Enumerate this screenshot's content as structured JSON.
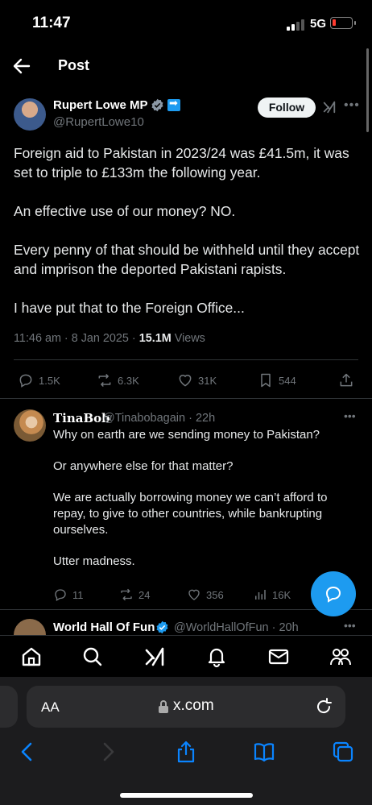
{
  "status_bar": {
    "time": "11:47",
    "network": "5G",
    "battery_color": "#ff3b30"
  },
  "nav": {
    "title": "Post"
  },
  "post": {
    "author_name": "Rupert Lowe MP",
    "author_handle": "@RupertLowe10",
    "follow_label": "Follow",
    "paragraphs": [
      "Foreign aid to Pakistan in 2023/24 was £41.5m, it was set to triple to £133m the following year.",
      "An effective use of our money? NO.",
      "Every penny of that should be withheld until they accept and imprison the deported Pakistani rapists.",
      "I have put that to the Foreign Office..."
    ],
    "timestamp": "11:46 am · 8 Jan 2025 · ",
    "views_count": "15.1M",
    "views_label": " Views",
    "stats": {
      "replies": "1.5K",
      "reposts": "6.3K",
      "likes": "31K",
      "bookmarks": "544"
    }
  },
  "reply": {
    "author_name": "TinaBob",
    "author_handle": "@Tinabobagain · 22h",
    "paragraphs": [
      "Why on earth are we sending money to Pakistan?",
      "Or anywhere else for that matter?",
      "We are actually borrowing money we can’t afford to repay, to give to other countries, while bankrupting ourselves.",
      "Utter madness."
    ],
    "stats": {
      "replies": "11",
      "reposts": "24",
      "likes": "356",
      "views": "16K"
    }
  },
  "reply2": {
    "author_name": "World Hall Of Fun",
    "author_handle": "@WorldHallOfFun · 20h"
  },
  "browser": {
    "aa_label": "AA",
    "url": "x.com"
  },
  "colors": {
    "accent": "#1d9bf0",
    "muted": "#71767b",
    "background": "#000000"
  }
}
